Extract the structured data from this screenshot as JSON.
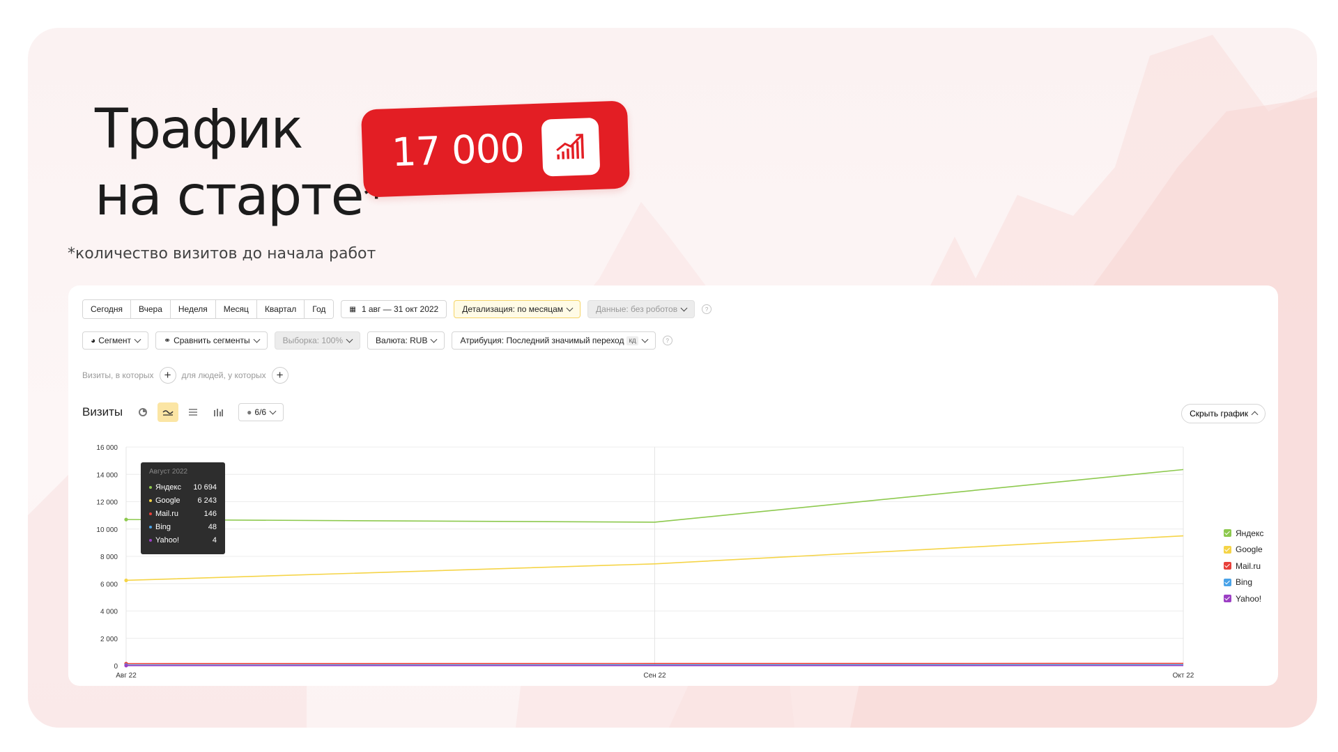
{
  "heading": {
    "line1": "Трафик",
    "line2": "на старте*"
  },
  "badge": {
    "value": "17 000",
    "icon": "growth-chart-icon"
  },
  "footnote": "*количество визитов до начала работ",
  "toolbar": {
    "periods": [
      "Сегодня",
      "Вчера",
      "Неделя",
      "Месяц",
      "Квартал",
      "Год"
    ],
    "date_range": "1 авг — 31 окт 2022",
    "detail": "Детализация: по месяцам",
    "data_filter": "Данные: без роботов",
    "segment": "Сегмент",
    "compare": "Сравнить сегменты",
    "sample": "Выборка: 100%",
    "currency": "Валюта: RUB",
    "attribution": "Атрибуция: Последний значимый переход",
    "attribution_tag": "кд",
    "visits_where": "Визиты, в которых",
    "people_where": "для людей, у которых"
  },
  "chart_controls": {
    "title": "Визиты",
    "series_count": "6/6",
    "hide": "Скрыть график"
  },
  "tooltip": {
    "title": "Август 2022",
    "rows": [
      {
        "name": "Яндекс",
        "value": "10 694"
      },
      {
        "name": "Google",
        "value": "6 243"
      },
      {
        "name": "Mail.ru",
        "value": "146"
      },
      {
        "name": "Bing",
        "value": "48"
      },
      {
        "name": "Yahoo!",
        "value": "4"
      }
    ]
  },
  "chart_data": {
    "type": "line",
    "title": "",
    "x": [
      "Авг 22",
      "Сен 22",
      "Окт 22"
    ],
    "yticks": [
      "0",
      "2 000",
      "4 000",
      "6 000",
      "8 000",
      "10 000",
      "12 000",
      "14 000",
      "16 000"
    ],
    "ylim": [
      0,
      16000
    ],
    "grid": true,
    "legend_position": "right",
    "series": [
      {
        "name": "Яндекс",
        "color": "#8dc94e",
        "values": [
          10694,
          10500,
          14350
        ]
      },
      {
        "name": "Google",
        "color": "#f5d447",
        "values": [
          6243,
          7450,
          9500
        ]
      },
      {
        "name": "Mail.ru",
        "color": "#e8403a",
        "values": [
          146,
          160,
          170
        ]
      },
      {
        "name": "Bing",
        "color": "#4aa3e8",
        "values": [
          48,
          60,
          70
        ]
      },
      {
        "name": "Yahoo!",
        "color": "#9c3fc4",
        "values": [
          4,
          5,
          6
        ]
      }
    ]
  }
}
